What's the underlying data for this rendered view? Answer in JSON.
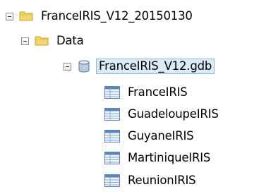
{
  "tree": {
    "root": {
      "label": "FranceIRIS_V12_20150130",
      "expander": "collapse",
      "icon": "folder-icon"
    },
    "data_folder": {
      "label": "Data",
      "expander": "collapse",
      "icon": "folder-icon"
    },
    "geodatabase": {
      "label": "FranceIRIS_V12.gdb",
      "expander": "collapse",
      "icon": "database-icon"
    },
    "tables": [
      {
        "label": "FranceIRIS",
        "icon": "table-icon"
      },
      {
        "label": "GuadeloupeIRIS",
        "icon": "table-icon"
      },
      {
        "label": "GuyaneIRIS",
        "icon": "table-icon"
      },
      {
        "label": "MartiniqueIRIS",
        "icon": "table-icon"
      },
      {
        "label": "ReunionIRIS",
        "icon": "table-icon"
      }
    ]
  },
  "colors": {
    "folder_fill": "#f5d56a",
    "folder_outline": "#c9a227",
    "database_fill": "#b8cde3",
    "table_header": "#5d86b8",
    "table_grid": "#8aa9cc"
  }
}
